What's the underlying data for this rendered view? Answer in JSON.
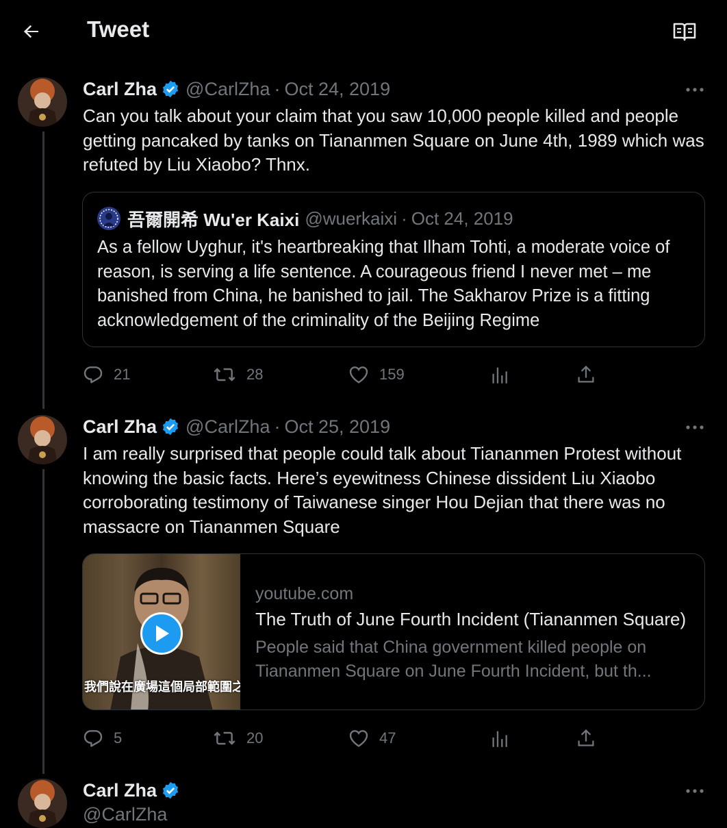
{
  "header": {
    "title": "Tweet",
    "back_icon": "arrow-left-icon",
    "reader_icon": "book-open-icon"
  },
  "colors": {
    "background": "#000000",
    "text": "#e7e9ea",
    "secondary": "#71767b",
    "border": "#2f3336",
    "accent": "#1d9bf0"
  },
  "tweets": [
    {
      "name": "Carl Zha",
      "handle": "@CarlZha",
      "separator": "·",
      "date": "Oct 24, 2019",
      "text": "Can you talk about your claim that you saw 10,000 people killed and people getting pancaked by tanks on Tiananmen Square on June 4th, 1989 which was refuted by Liu Xiaobo? Thnx.",
      "quote": {
        "name": "吾爾開希 Wu'er Kaixi",
        "handle": "@wuerkaixi",
        "separator": "·",
        "date": "Oct 24, 2019",
        "text": "As a fellow Uyghur, it's heartbreaking that Ilham Tohti, a moderate voice of reason, is serving a life sentence. A courageous friend I never met – me banished from China, he banished to jail. The Sakharov Prize is a fitting acknowledgement of the criminality of the Beijing Regime"
      },
      "stats": {
        "replies": "21",
        "retweets": "28",
        "likes": "159"
      }
    },
    {
      "name": "Carl Zha",
      "handle": "@CarlZha",
      "separator": "·",
      "date": "Oct 25, 2019",
      "text": "I am really surprised that people could talk about Tiananmen Protest without knowing the basic facts. Here’s eyewitness Chinese dissident Liu Xiaobo corroborating testimony of Taiwanese singer Hou Dejian that there was no massacre on Tiananmen Square",
      "card": {
        "domain": "youtube.com",
        "title": "The Truth of June Fourth Incident (Tiananmen Square)",
        "description": "People said that China government killed people on Tiananmen Square on June Fourth Incident, but th...",
        "video_subtitle": "我們說在廣場這個局部範圍之內"
      },
      "stats": {
        "replies": "5",
        "retweets": "20",
        "likes": "47"
      }
    },
    {
      "name": "Carl Zha",
      "handle": "@CarlZha"
    }
  ]
}
